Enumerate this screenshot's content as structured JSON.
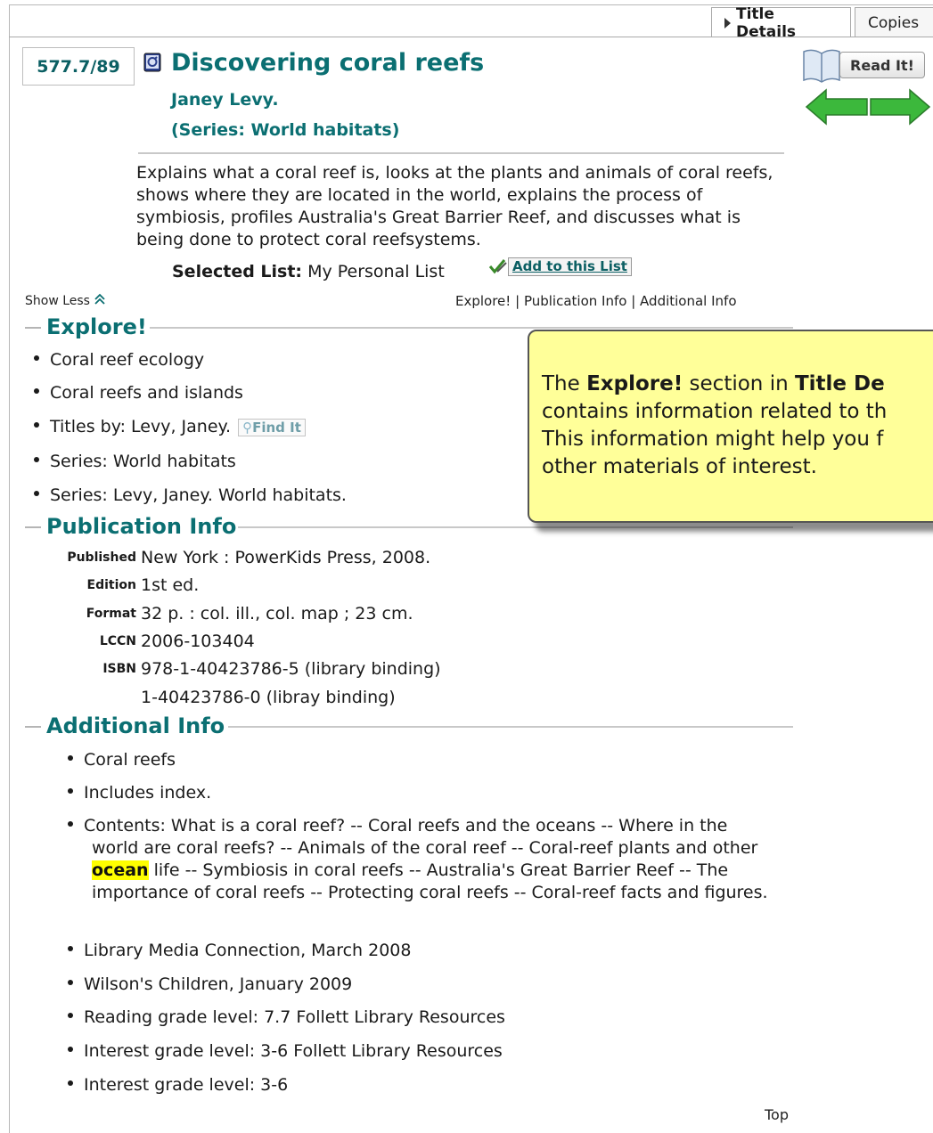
{
  "tabs": {
    "title_details": "Title Details",
    "copies": "Copies"
  },
  "record": {
    "call_number": "577.7/89",
    "title": "Discovering coral reefs",
    "author": "Janey Levy.",
    "series": "(Series: World habitats)",
    "summary": "Explains what a coral reef is, looks at the plants and animals of coral reefs, shows where they are located in the world, explains the process of symbiosis, profiles Australia's Great Barrier Reef, and discusses what is being done to protect coral reefsystems.",
    "selected_list_label": "Selected List:",
    "selected_list_value": "My Personal List",
    "add_to_list": "Add to this List"
  },
  "actions": {
    "read_it": "Read It!"
  },
  "nav": {
    "show_less": "Show Less",
    "links": [
      "Explore!",
      "Publication Info",
      "Additional Info"
    ],
    "separator": "|",
    "top": "Top"
  },
  "explore": {
    "heading": "Explore!",
    "items": [
      "Coral reef ecology",
      "Coral reefs and islands",
      "Titles by: Levy, Janey.",
      "Series: World habitats",
      "Series: Levy, Janey. World habitats."
    ],
    "find_it": "Find It"
  },
  "publication": {
    "heading": "Publication Info",
    "rows": [
      {
        "key": "Published",
        "value": "New York : PowerKids Press, 2008."
      },
      {
        "key": "Edition",
        "value": "1st ed."
      },
      {
        "key": "Format",
        "value": "32 p. : col. ill., col. map ; 23 cm."
      },
      {
        "key": "LCCN",
        "value": "2006-103404"
      },
      {
        "key": "ISBN",
        "value": "978-1-40423786-5 (library binding)"
      },
      {
        "key": "",
        "value": "1-40423786-0 (libray binding)"
      }
    ]
  },
  "additional": {
    "heading": "Additional Info",
    "items": [
      "Coral reefs",
      "Includes index.",
      "Library Media Connection, March 2008",
      "Wilson's Children, January 2009",
      "Reading grade level: 7.7 Follett Library Resources",
      "Interest grade level: 3-6 Follett Library Resources",
      "Interest grade level: 3-6"
    ],
    "contents_before": "Contents: What is a coral reef? -- Coral reefs and the oceans -- Where in the world are coral reefs? -- Animals of the coral reef -- Coral-reef plants and other",
    "contents_highlight": "ocean",
    "contents_after": "life -- Symbiosis in coral reefs -- Australia's Great Barrier Reef -- The importance of coral reefs -- Protecting coral reefs -- Coral-reef facts and figures."
  },
  "tooltip": {
    "pre1": "The",
    "bold1": "Explore!",
    "mid1": "section in",
    "bold2": "Title De",
    "line2": "contains information related to th",
    "line3": "This information might help you f",
    "line4": "other materials of interest."
  },
  "colors": {
    "heading_teal": "#0b6f72",
    "tooltip_bg": "#ffff99",
    "highlight": "#ffff00",
    "arrow_green": "#3cb83c"
  }
}
